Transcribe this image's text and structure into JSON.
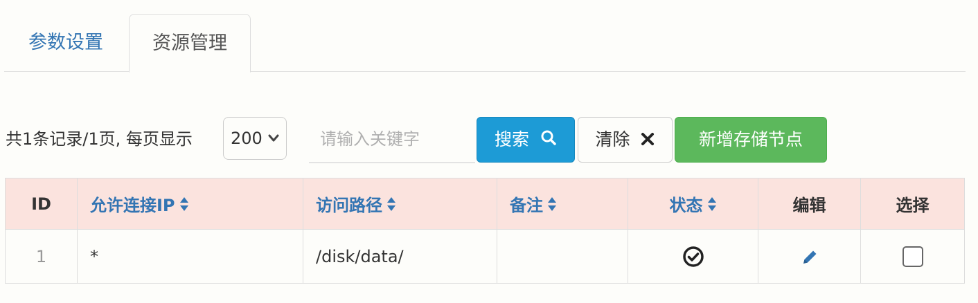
{
  "tabs": [
    {
      "label": "参数设置",
      "active": false
    },
    {
      "label": "资源管理",
      "active": true
    }
  ],
  "toolbar": {
    "summary_text": "共1条记录/1页, 每页显示",
    "page_size": "200",
    "search_placeholder": "请输入关键字",
    "search_label": "搜索",
    "clear_label": "清除",
    "add_label": "新增存储节点"
  },
  "table": {
    "headers": [
      "ID",
      "允许连接IP",
      "访问路径",
      "备注",
      "状态",
      "编辑",
      "选择"
    ],
    "rows": [
      {
        "id": "1",
        "ip": "*",
        "path": "/disk/data/",
        "remark": "",
        "status": "check-circle-icon",
        "edit": "pencil-icon",
        "select": false
      }
    ]
  },
  "colors": {
    "link": "#3375b3",
    "header_bg": "#fbe3de",
    "search_btn": "#1d9bd6",
    "add_btn": "#5cb85c"
  }
}
